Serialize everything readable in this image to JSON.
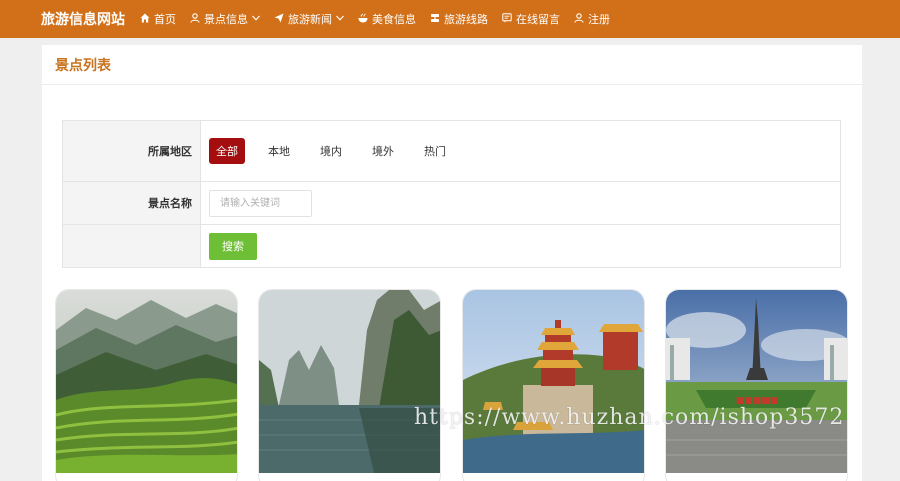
{
  "navbar": {
    "brand": "旅游信息网站",
    "items": [
      {
        "label": "首页",
        "icon": "home-icon",
        "caret": false
      },
      {
        "label": "景点信息",
        "icon": "user-icon",
        "caret": true
      },
      {
        "label": "旅游新闻",
        "icon": "send-icon",
        "caret": true
      },
      {
        "label": "美食信息",
        "icon": "food-icon",
        "caret": false
      },
      {
        "label": "旅游线路",
        "icon": "route-icon",
        "caret": false
      },
      {
        "label": "在线留言",
        "icon": "message-icon",
        "caret": false
      },
      {
        "label": "注册",
        "icon": "user-icon",
        "caret": false
      }
    ],
    "colors": {
      "background": "#d2701a"
    }
  },
  "panel": {
    "title": "景点列表",
    "title_color": "#c8741f"
  },
  "filter": {
    "region_label": "所属地区",
    "region_options": [
      "全部",
      "本地",
      "境内",
      "境外",
      "热门"
    ],
    "region_selected": "全部",
    "name_label": "景点名称",
    "search_placeholder": "请输入关键词",
    "search_value": "",
    "search_button": "搜索",
    "colors": {
      "active": "#a40e0e",
      "button": "#6ebf35"
    }
  },
  "cards": [
    {
      "image": "terraced-mountains"
    },
    {
      "image": "karst-lake"
    },
    {
      "image": "chinese-pagoda"
    },
    {
      "image": "eiffel-replica"
    }
  ],
  "watermark": "https://www.huzhan.com/ishop3572"
}
